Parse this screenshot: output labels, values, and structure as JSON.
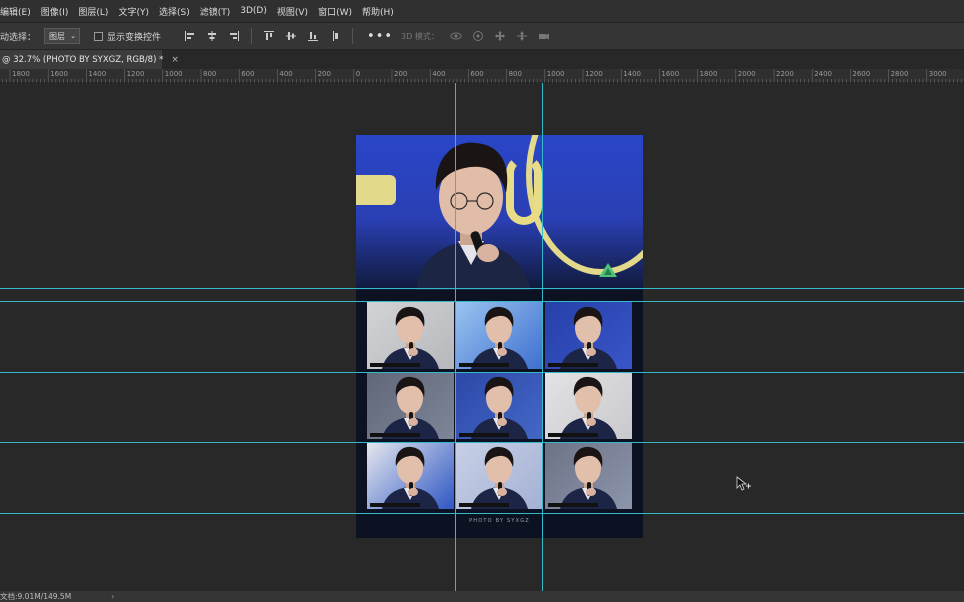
{
  "menu": {
    "items": [
      "编辑(E)",
      "图像(I)",
      "图层(L)",
      "文字(Y)",
      "选择(S)",
      "滤镜(T)",
      "3D(D)",
      "视图(V)",
      "窗口(W)",
      "帮助(H)"
    ]
  },
  "options": {
    "auto_select_label": "动选择：",
    "auto_select_value": "图层",
    "show_transform_label": "显示变换控件",
    "mode_3d_label": "3D 模式："
  },
  "document_tab": {
    "title": "@ 32.7% (PHOTO BY SYXGZ, RGB/8) *",
    "close": "×"
  },
  "ruler": {
    "labels": [
      "1800",
      "1600",
      "1400",
      "1200",
      "1000",
      "800",
      "600",
      "400",
      "200",
      "0",
      "200",
      "400",
      "600",
      "800",
      "1000",
      "1200",
      "1400",
      "1600",
      "1800",
      "2000",
      "2200",
      "2400",
      "2600",
      "2800",
      "3000"
    ]
  },
  "document": {
    "credit": "PHOTO BY SYXGZ"
  },
  "status": {
    "doc_size": "文档:9.01M/149.5M",
    "arrow": "›"
  },
  "colors": {
    "guide": "#33b9c9",
    "hero_blue": "#2a3fb3",
    "arc_yellow": "#d9d27a"
  }
}
